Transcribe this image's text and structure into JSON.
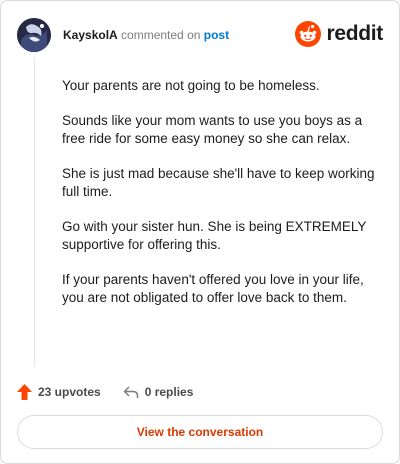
{
  "header": {
    "username": "KayskolA",
    "verb": " commented on ",
    "post_link": "post",
    "logo_text": "reddit"
  },
  "comment": {
    "paragraphs": [
      "Your parents are not going to be homeless.",
      "Sounds like your mom wants to use you boys as a free ride for some easy money so she can relax.",
      "She is just mad because she'll have to keep working full time.",
      "Go with your sister hun. She is being EXTREMELY supportive for offering this.",
      "If your parents haven't offered you love in your life, you are not obligated to offer love back to them."
    ]
  },
  "actions": {
    "upvotes": "23 upvotes",
    "replies": "0 replies"
  },
  "cta": {
    "label": "View the conversation"
  },
  "colors": {
    "brand": "#ff4500",
    "link": "#0079d3",
    "cta_text": "#d93a00"
  }
}
